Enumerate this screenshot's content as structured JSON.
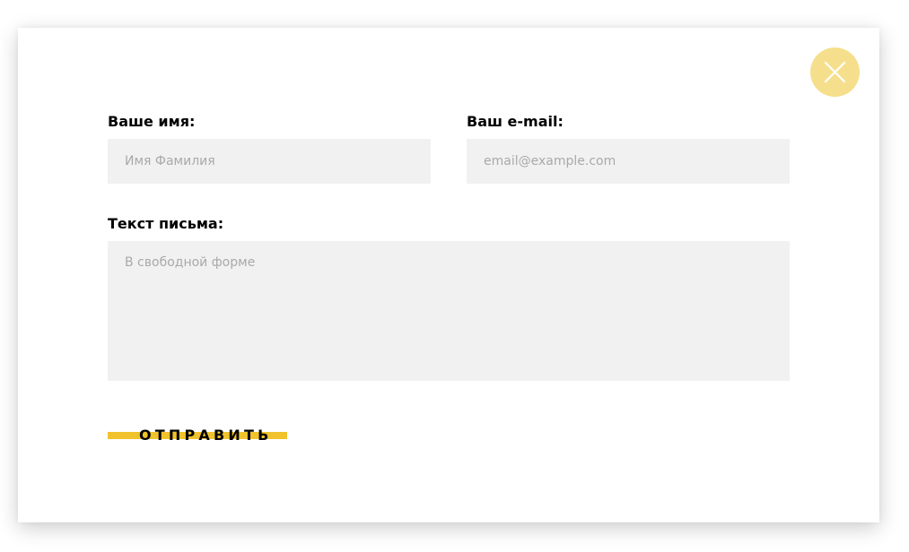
{
  "form": {
    "name": {
      "label": "Ваше имя:",
      "placeholder": "Имя Фамилия",
      "value": ""
    },
    "email": {
      "label": "Ваш e-mail:",
      "placeholder": "email@example.com",
      "value": ""
    },
    "message": {
      "label": "Текст письма:",
      "placeholder": "В свободной форме",
      "value": ""
    },
    "submit_label": "ОТПРАВИТЬ"
  },
  "close_button": {
    "icon": "close-icon"
  },
  "colors": {
    "accent": "#f0c32c",
    "close_button_bg": "#f6df8c",
    "input_bg": "#f1f1f1",
    "placeholder": "#a9a9a9"
  }
}
